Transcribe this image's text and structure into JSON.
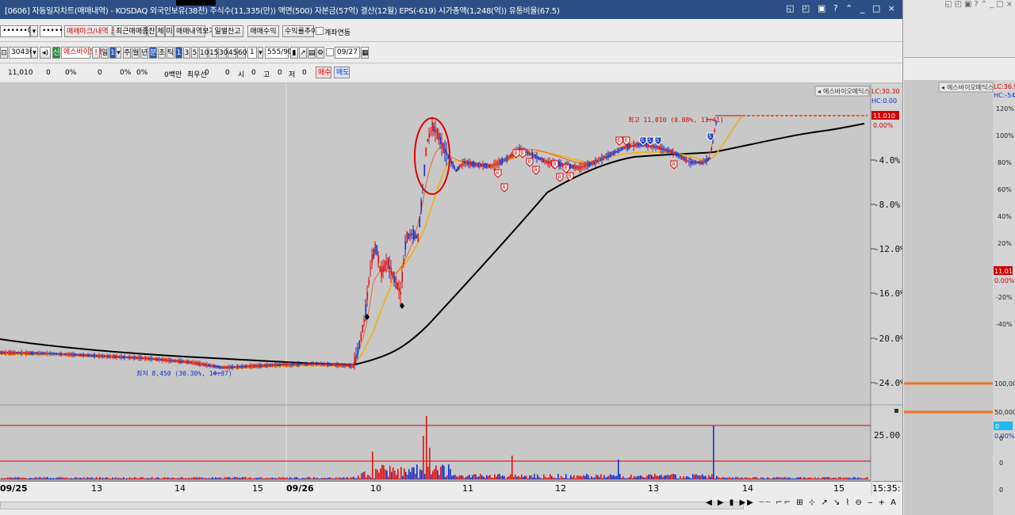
{
  "window": {
    "title": "[0606] 자동일자차트(매매내역) - KOSDAQ 외국인보유(38천) 주식수(11,335(만)) 액면(500) 자본금(57억) 결산(12월) EPS(-619) 시가총액(1,248(억)) 유통비율(67.5)",
    "controls": "◱ ◰ ▣ ? ⌃ _ □ ×"
  },
  "right_panel": {
    "top_controls": "◱◰▣?⌃_□×",
    "stock_label": "에스바이오메딕스",
    "lc": "LC:36.9",
    "hc": "HC:-54.",
    "price": "11.01",
    "price_pct": "0.00%",
    "pct_ticks": [
      "120%",
      "100%",
      "80%",
      "60%",
      "40%",
      "20%",
      "0%",
      "-20%",
      "-40%"
    ],
    "vol_ticks": [
      "100,000",
      "50,000",
      "0"
    ],
    "vol_value": "0",
    "vol_pct": "0.00%",
    "bottom_ticks": [
      "0",
      "0"
    ]
  },
  "toolbar1": {
    "account": "••••••06",
    "password": "••••••••",
    "buttons": [
      "매매마크/내역 조회",
      "최근매매종목",
      "잔",
      "체",
      "미",
      "매매내역보기",
      "일별잔고",
      "매매수익",
      "수익률추이"
    ],
    "checkbox_label": "계좌연동"
  },
  "toolbar2": {
    "code": "304360",
    "stock_name": "에스바이오메",
    "periods": [
      "일",
      "주",
      "월",
      "년",
      "분",
      "초",
      "틱"
    ],
    "selected_period": "분",
    "intervals": [
      "1",
      "3",
      "5",
      "10",
      "15",
      "30",
      "45",
      "60"
    ],
    "selected_interval": "1",
    "interval_input": "1",
    "count": "555/900",
    "date": "09/27"
  },
  "toolbar3": {
    "values": [
      "11,010",
      "0",
      "0%",
      "0",
      "0%",
      "0%",
      "0백만",
      "최우선",
      "0",
      "0",
      "시",
      "0",
      "고",
      "0",
      "저",
      "0"
    ],
    "buy_label": "매수",
    "sell_label": "매도"
  },
  "chart": {
    "stock_label": "에스바이오메딕스",
    "lc": "LC:30.30",
    "hc": "HC:0.00",
    "price_axis": [
      "-4.0%",
      "-8.0%",
      "-12.0%",
      "-16.0%",
      "-20.0%",
      "-24.0%"
    ],
    "current_price": "11.010",
    "current_pct": "0.00%",
    "high_label": "최고 11,010 (0.08%, 13:41)",
    "low_label": "최저 8,450 (30.30%, 14:37)",
    "volume_axis": "25.00",
    "x_labels": [
      "09/25",
      "13",
      "14",
      "15",
      "09/26",
      "10",
      "11",
      "12",
      "13",
      "14",
      "15"
    ],
    "time": "15:35:",
    "colors": {
      "up": "#e01010",
      "down": "#1030d0",
      "ma_long": "#000000",
      "ma_short": "#f0b000",
      "ma_fast": "#f08020"
    }
  },
  "bottom_bar": {
    "controls": "◀ ▶ ▮ ▶▶ ┈┈ ⌐⌐ ⊞ ⊹ ↗ ↘ ⌇ ⊖ ‒ + A"
  }
}
